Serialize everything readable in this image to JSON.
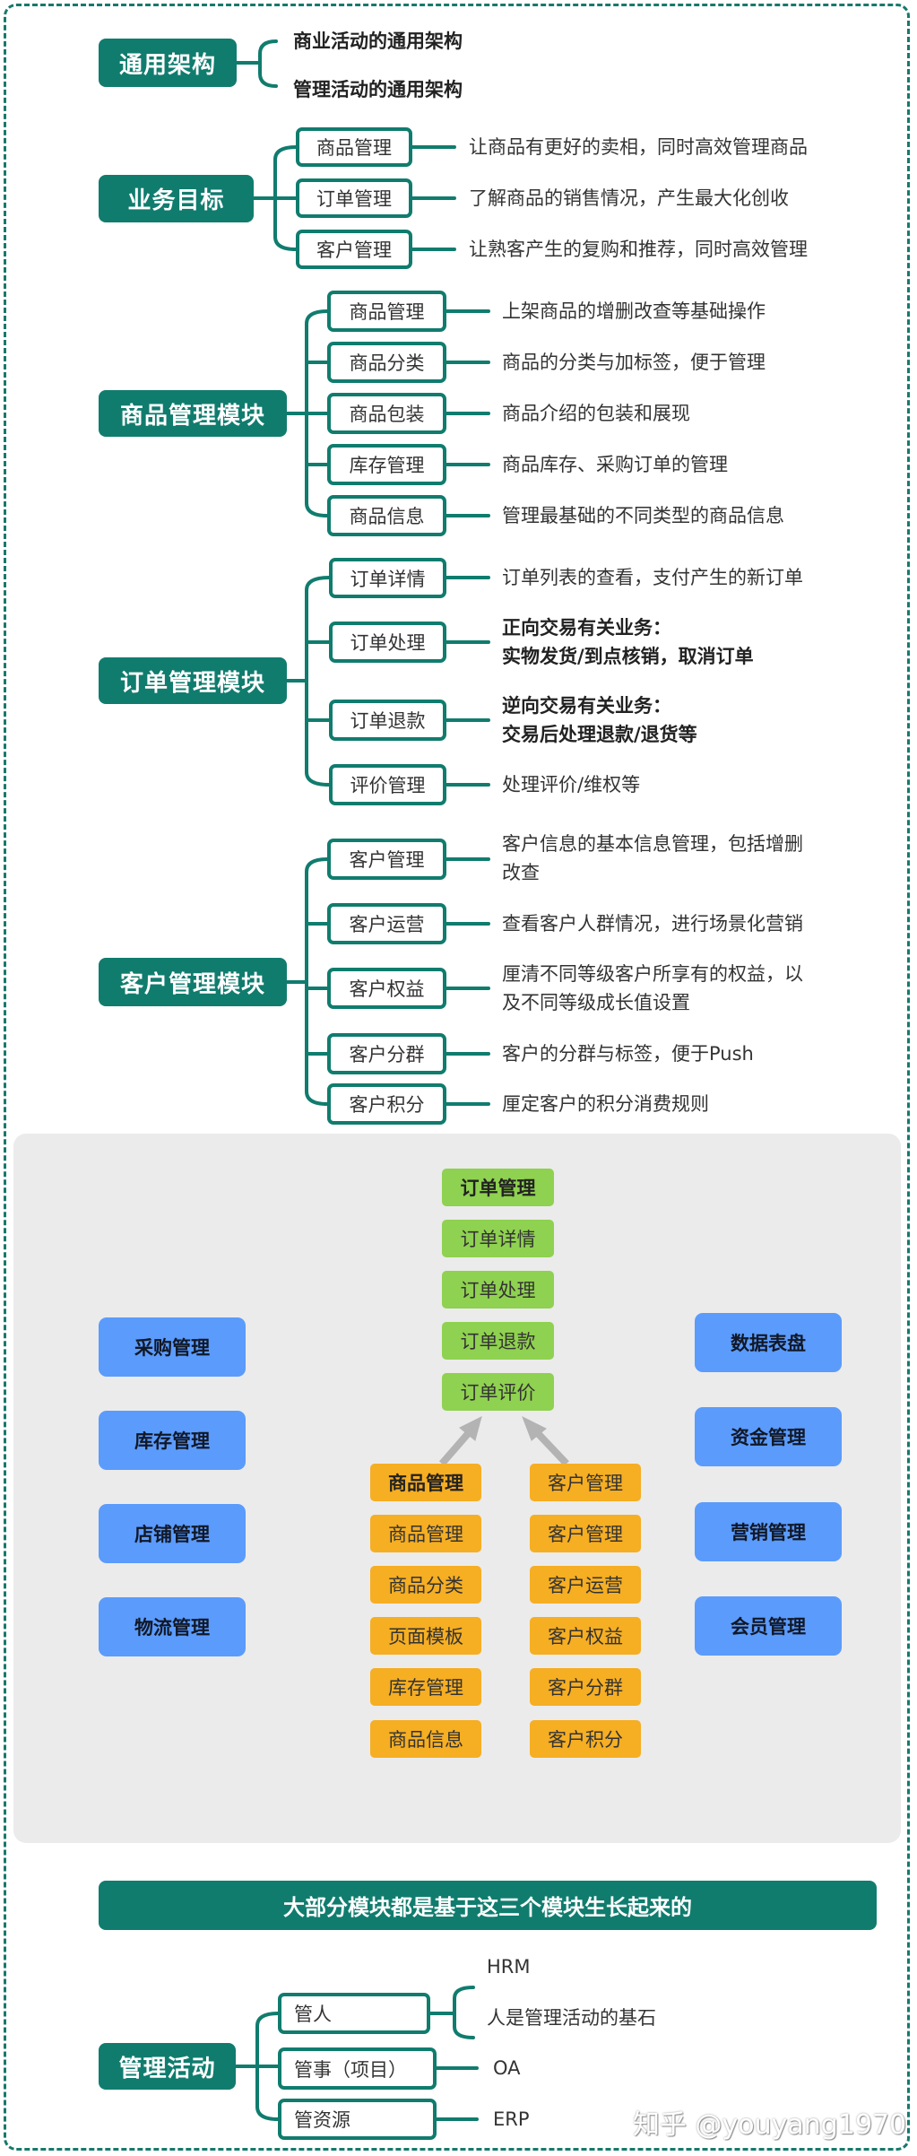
{
  "general": {
    "root": "通用架构",
    "items": [
      "商业活动的通用架构",
      "管理活动的通用架构"
    ]
  },
  "business": {
    "root": "业务目标",
    "items": [
      {
        "label": "商品管理",
        "desc": "让商品有更好的卖相，同时高效管理商品"
      },
      {
        "label": "订单管理",
        "desc": "了解商品的销售情况，产生最大化创收"
      },
      {
        "label": "客户管理",
        "desc": "让熟客产生的复购和推荐，同时高效管理"
      }
    ]
  },
  "product_module": {
    "root": "商品管理模块",
    "items": [
      {
        "label": "商品管理",
        "desc": "上架商品的增删改查等基础操作"
      },
      {
        "label": "商品分类",
        "desc": "商品的分类与加标签，便于管理"
      },
      {
        "label": "商品包装",
        "desc": "商品介绍的包装和展现"
      },
      {
        "label": "库存管理",
        "desc": "商品库存、采购订单的管理"
      },
      {
        "label": "商品信息",
        "desc": "管理最基础的不同类型的商品信息"
      }
    ]
  },
  "order_module": {
    "root": "订单管理模块",
    "items": [
      {
        "label": "订单详情",
        "desc": [
          "订单列表的查看，支付产生的新订单"
        ],
        "bold": false
      },
      {
        "label": "订单处理",
        "desc": [
          "正向交易有关业务：",
          "实物发货/到点核销，取消订单"
        ],
        "bold": true
      },
      {
        "label": "订单退款",
        "desc": [
          "逆向交易有关业务：",
          "交易后处理退款/退货等"
        ],
        "bold": true
      },
      {
        "label": "评价管理",
        "desc": [
          "处理评价/维权等"
        ],
        "bold": false
      }
    ]
  },
  "customer_module": {
    "root": "客户管理模块",
    "items": [
      {
        "label": "客户管理",
        "desc": [
          "客户信息的基本信息管理，包括增删",
          "改查"
        ]
      },
      {
        "label": "客户运营",
        "desc": [
          "查看客户人群情况，进行场景化营销"
        ]
      },
      {
        "label": "客户权益",
        "desc": [
          "厘清不同等级客户所享有的权益，以",
          "及不同等级成长值设置"
        ]
      },
      {
        "label": "客户分群",
        "desc": [
          "客户的分群与标签，便于Push"
        ]
      },
      {
        "label": "客户积分",
        "desc": [
          "厘定客户的积分消费规则"
        ]
      }
    ]
  },
  "panel": {
    "order_stack": [
      "订单管理",
      "订单详情",
      "订单处理",
      "订单退款",
      "订单评价"
    ],
    "product_stack": [
      "商品管理",
      "商品管理",
      "商品分类",
      "页面模板",
      "库存管理",
      "商品信息"
    ],
    "customer_stack": [
      "客户管理",
      "客户管理",
      "客户运营",
      "客户权益",
      "客户分群",
      "客户积分"
    ],
    "left_modules": [
      "采购管理",
      "库存管理",
      "店铺管理",
      "物流管理"
    ],
    "right_modules": [
      "数据表盘",
      "资金管理",
      "营销管理",
      "会员管理"
    ],
    "colors": {
      "order": "#8fd150",
      "product_customer": "#f6ae22",
      "peripheral": "#5b9bfb",
      "arrow": "#b3b3b3"
    }
  },
  "banner": "大部分模块都是基于这三个模块生长起来的",
  "management": {
    "root": "管理活动",
    "items": [
      {
        "label": "管人",
        "desc": [
          "HRM",
          "人是管理活动的基石"
        ]
      },
      {
        "label": "管事（项目）",
        "desc": [
          "OA"
        ]
      },
      {
        "label": "管资源",
        "desc": [
          "ERP"
        ]
      }
    ]
  },
  "watermark": "知乎 @youyang1970",
  "colors": {
    "teal": "#107c6e",
    "panel_bg": "#ebebeb"
  }
}
